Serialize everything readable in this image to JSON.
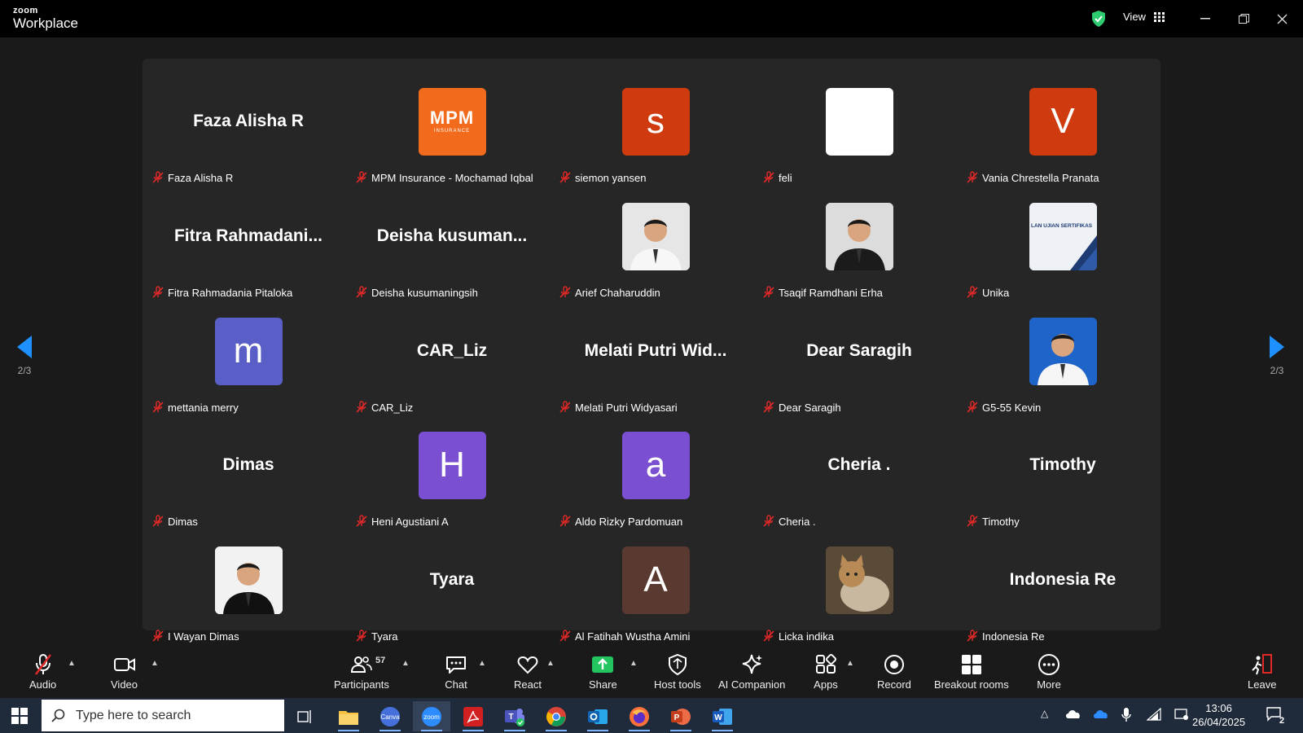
{
  "app": {
    "brand_small": "zoom",
    "brand_large": "Workplace"
  },
  "titlebar": {
    "view_label": "View"
  },
  "pager": {
    "prev_count": "2/3",
    "next_count": "2/3"
  },
  "colors": {
    "shield": "#2ecc71",
    "arrow": "#1e90ff",
    "mute": "#e02828",
    "share": "#22c55e",
    "leave": "#e02828"
  },
  "tiles": [
    {
      "name": "Faza Alisha R",
      "display": "Faza Alisha R",
      "kind": "text"
    },
    {
      "name": "MPM Insurance - Mochamad Iqbal",
      "kind": "logo",
      "color": "#f26b1d",
      "logo_text": "MPM",
      "logo_sub": "INSURANCE"
    },
    {
      "name": "siemon yansen",
      "kind": "letter",
      "letter": "s",
      "color": "#cf3b0f"
    },
    {
      "name": "feli",
      "kind": "blank",
      "color": "#ffffff"
    },
    {
      "name": "Vania Chrestella Pranata",
      "kind": "letter",
      "letter": "V",
      "color": "#cf3b0f"
    },
    {
      "name": "Fitra Rahmadania Pitaloka",
      "display": "Fitra  Rahmadani...",
      "kind": "text"
    },
    {
      "name": "Deisha kusumaningsih",
      "display": "Deisha  kusuman...",
      "kind": "text"
    },
    {
      "name": "Arief Chaharuddin",
      "kind": "photo",
      "color": "#e6e6e6",
      "photo": "person-white-shirt"
    },
    {
      "name": "Tsaqif Ramdhani Erha",
      "kind": "photo",
      "color": "#dcdcdc",
      "photo": "person-dark-suit"
    },
    {
      "name": "Unika",
      "kind": "photo",
      "color": "#e8eef5",
      "photo": "certificate-banner",
      "photo_text": "LAN UJIAN SERTIFIKAS"
    },
    {
      "name": "mettania merry",
      "kind": "letter",
      "letter": "m",
      "color": "#5a5fc7"
    },
    {
      "name": "CAR_Liz",
      "display": "CAR_Liz",
      "kind": "text"
    },
    {
      "name": "Melati Putri Widyasari",
      "display": "Melati  Putri  Wid...",
      "kind": "text"
    },
    {
      "name": "Dear Saragih",
      "display": "Dear Saragih",
      "kind": "text"
    },
    {
      "name": "G5-55 Kevin",
      "kind": "photo",
      "color": "#1f64c9",
      "photo": "person-blue-bg"
    },
    {
      "name": "Dimas",
      "display": "Dimas",
      "kind": "text"
    },
    {
      "name": "Heni Agustiani A",
      "kind": "letter",
      "letter": "H",
      "color": "#7a4fd1"
    },
    {
      "name": "Aldo Rizky Pardomuan",
      "kind": "letter",
      "letter": "a",
      "color": "#7a4fd1"
    },
    {
      "name": "Cheria .",
      "display": "Cheria .",
      "kind": "text"
    },
    {
      "name": "Timothy",
      "display": "Timothy",
      "kind": "text"
    },
    {
      "name": "I Wayan Dimas",
      "kind": "photo",
      "color": "#f2f2f2",
      "photo": "person-formal"
    },
    {
      "name": "Tyara",
      "display": "Tyara",
      "kind": "text"
    },
    {
      "name": "Al Fatihah Wustha Amini",
      "kind": "letter",
      "letter": "A",
      "color": "#5a3a30"
    },
    {
      "name": "Licka indika",
      "kind": "photo",
      "color": "#6b5a44",
      "photo": "cat"
    },
    {
      "name": "Indonesia Re",
      "display": "Indonesia Re",
      "kind": "text"
    }
  ],
  "toolbar": {
    "audio": "Audio",
    "video": "Video",
    "participants": "Participants",
    "participants_count": "57",
    "chat": "Chat",
    "react": "React",
    "share": "Share",
    "host_tools": "Host tools",
    "ai_companion": "AI Companion",
    "apps": "Apps",
    "record": "Record",
    "breakout": "Breakout rooms",
    "more": "More",
    "leave": "Leave"
  },
  "taskbar": {
    "search_placeholder": "Type here to search",
    "time": "13:06",
    "date": "26/04/2025",
    "notifications": "2"
  }
}
